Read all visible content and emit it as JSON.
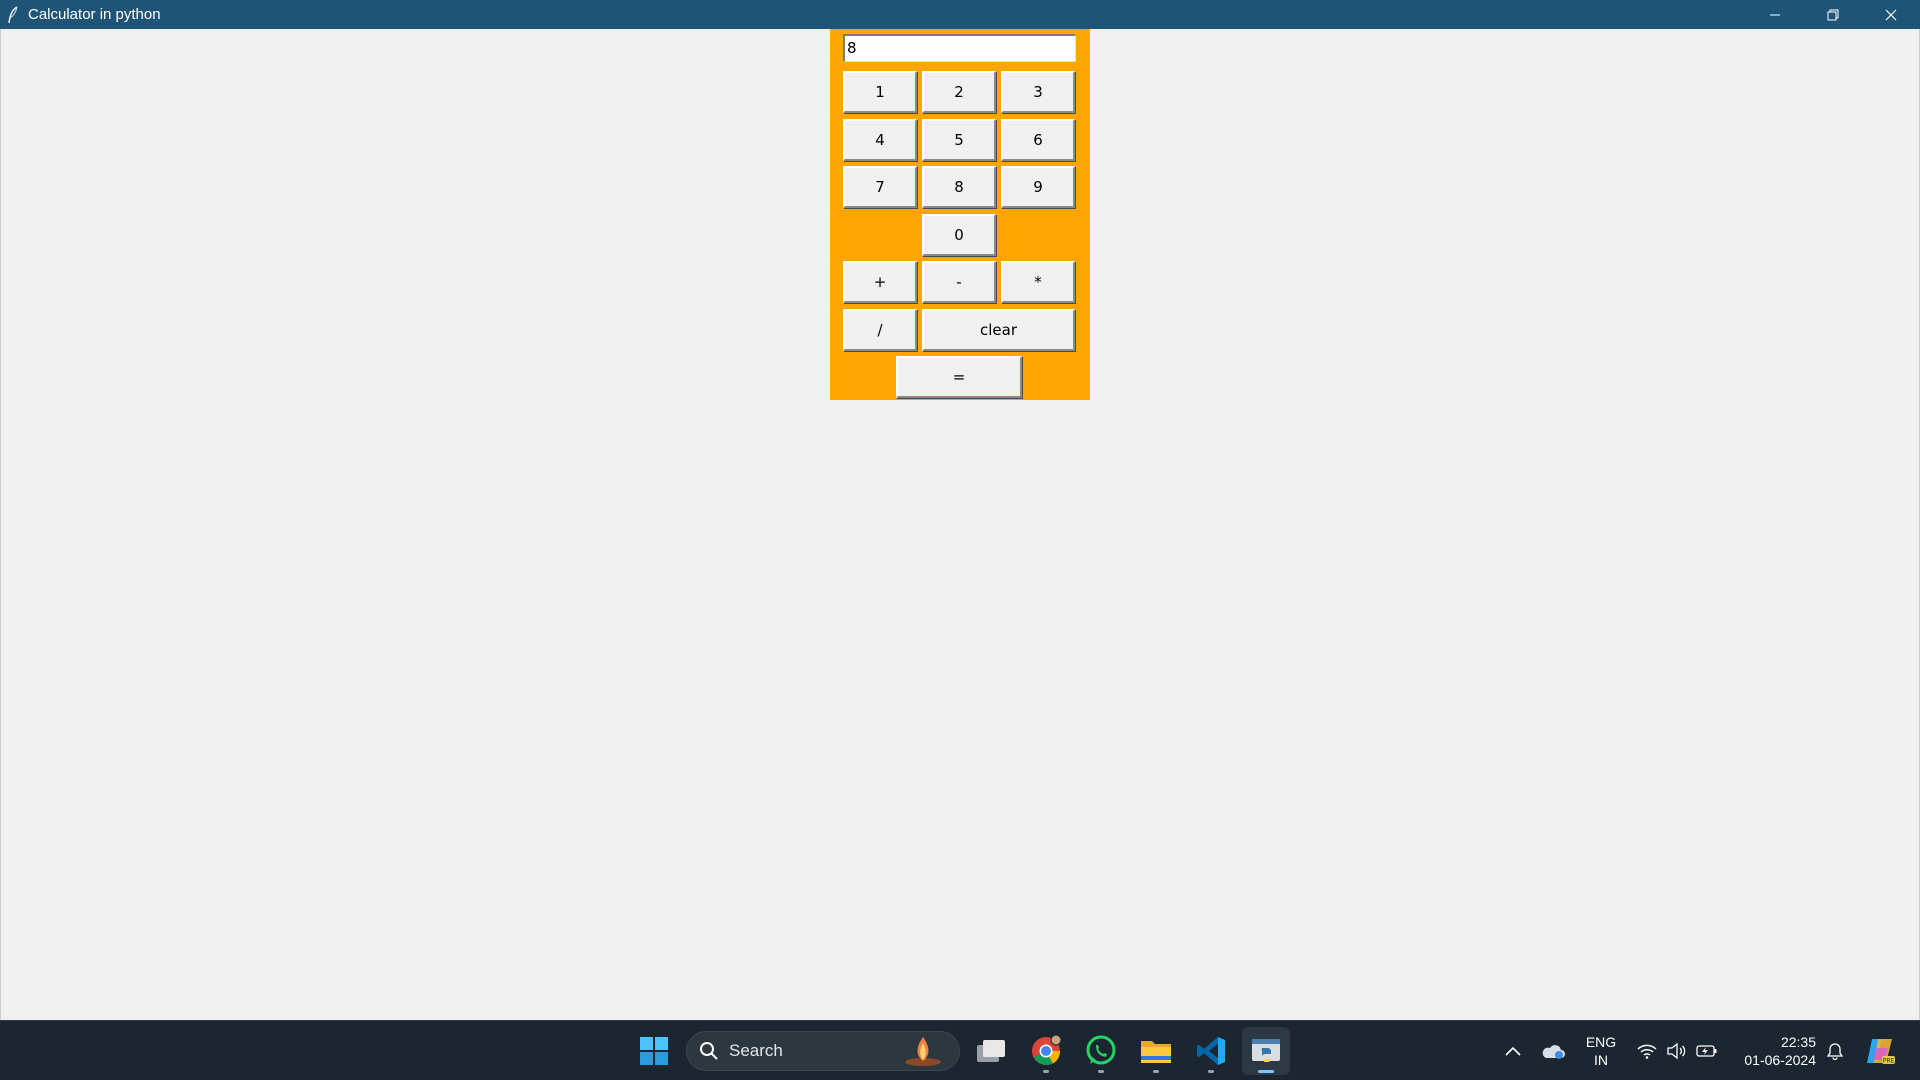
{
  "window": {
    "title": "Calculator in python",
    "icon": "feather-icon",
    "controls": [
      "minimize-icon",
      "restore-icon",
      "close-icon"
    ]
  },
  "calculator": {
    "panel_color": "#ffa500",
    "display_value": "8",
    "buttons": {
      "b1": "1",
      "b2": "2",
      "b3": "3",
      "b4": "4",
      "b5": "5",
      "b6": "6",
      "b7": "7",
      "b8": "8",
      "b9": "9",
      "b0": "0",
      "plus": "+",
      "minus": "-",
      "multiply": "*",
      "divide": "/",
      "clear": "clear",
      "equals": "="
    }
  },
  "taskbar": {
    "search_placeholder": "Search",
    "apps": [
      "windows-start-icon",
      "task-view-icon",
      "chrome-icon",
      "whatsapp-icon",
      "file-explorer-icon",
      "vscode-icon",
      "python-icon"
    ],
    "tray": {
      "lang_line1": "ENG",
      "lang_line2": "IN",
      "time": "22:35",
      "date": "01-06-2024"
    }
  }
}
